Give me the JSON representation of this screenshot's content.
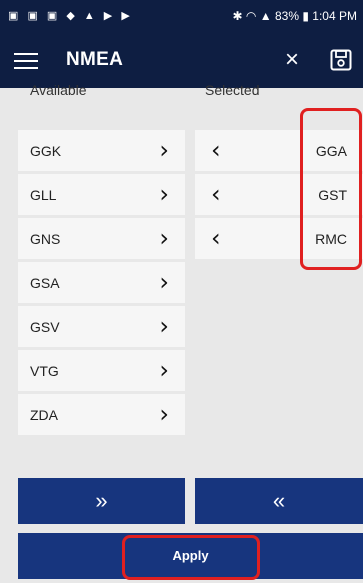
{
  "status_bar": {
    "battery": "83%",
    "time": "1:04 PM"
  },
  "app_bar": {
    "title": "NMEA",
    "close_icon": "×"
  },
  "columns": {
    "available_label": "Available",
    "selected_label": "Selected"
  },
  "available": [
    {
      "label": "GGK"
    },
    {
      "label": "GLL"
    },
    {
      "label": "GNS"
    },
    {
      "label": "GSA"
    },
    {
      "label": "GSV"
    },
    {
      "label": "VTG"
    },
    {
      "label": "ZDA"
    }
  ],
  "selected": [
    {
      "label": "GGA"
    },
    {
      "label": "GST"
    },
    {
      "label": "RMC"
    }
  ],
  "buttons": {
    "add_all": "»",
    "remove_all": "«",
    "apply": "Apply"
  },
  "colors": {
    "app_bar": "#0e1e42",
    "button": "#17357e",
    "highlight": "#e02020"
  }
}
